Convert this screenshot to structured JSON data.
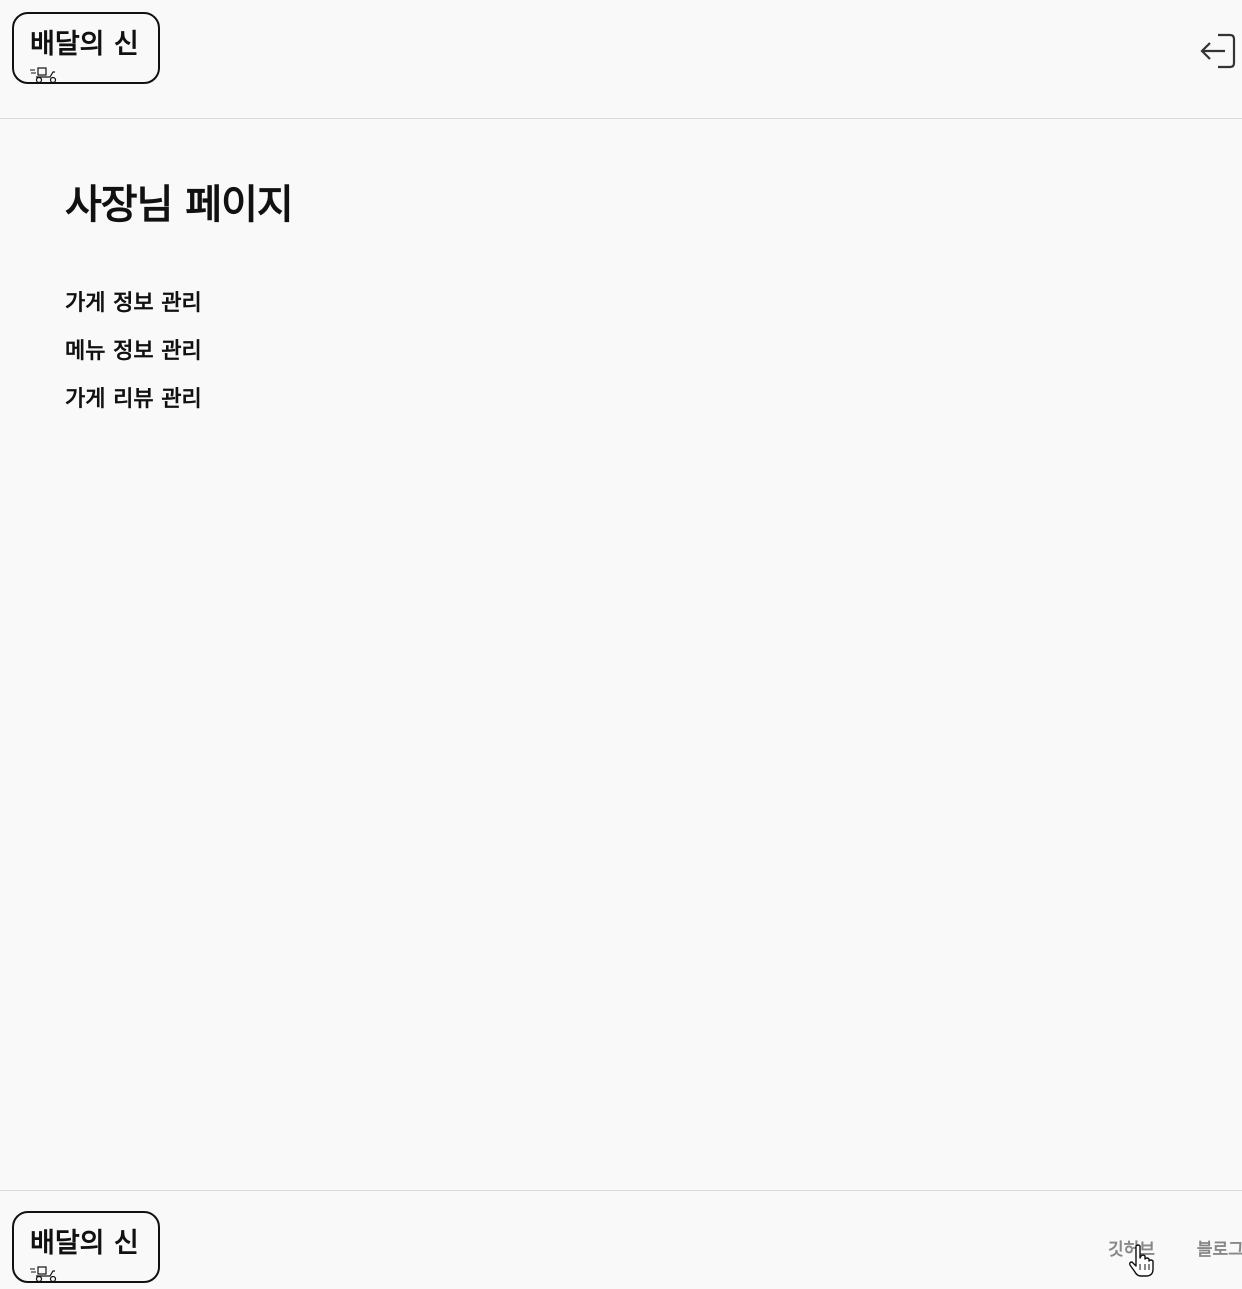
{
  "header": {
    "logo_text": "배달의 신",
    "logo_icon": "scooter-icon",
    "logout_icon": "logout-icon"
  },
  "main": {
    "title": "사장님 페이지",
    "menu": [
      {
        "label": "가게 정보 관리"
      },
      {
        "label": "메뉴 정보 관리"
      },
      {
        "label": "가게 리뷰 관리"
      }
    ]
  },
  "footer": {
    "logo_text": "배달의 신",
    "links": [
      {
        "label": "깃허브"
      },
      {
        "label": "블로그"
      }
    ]
  },
  "colors": {
    "background": "#f9f9f9",
    "text": "#111111",
    "footer_link": "#888888",
    "divider": "#dcdcdc"
  }
}
